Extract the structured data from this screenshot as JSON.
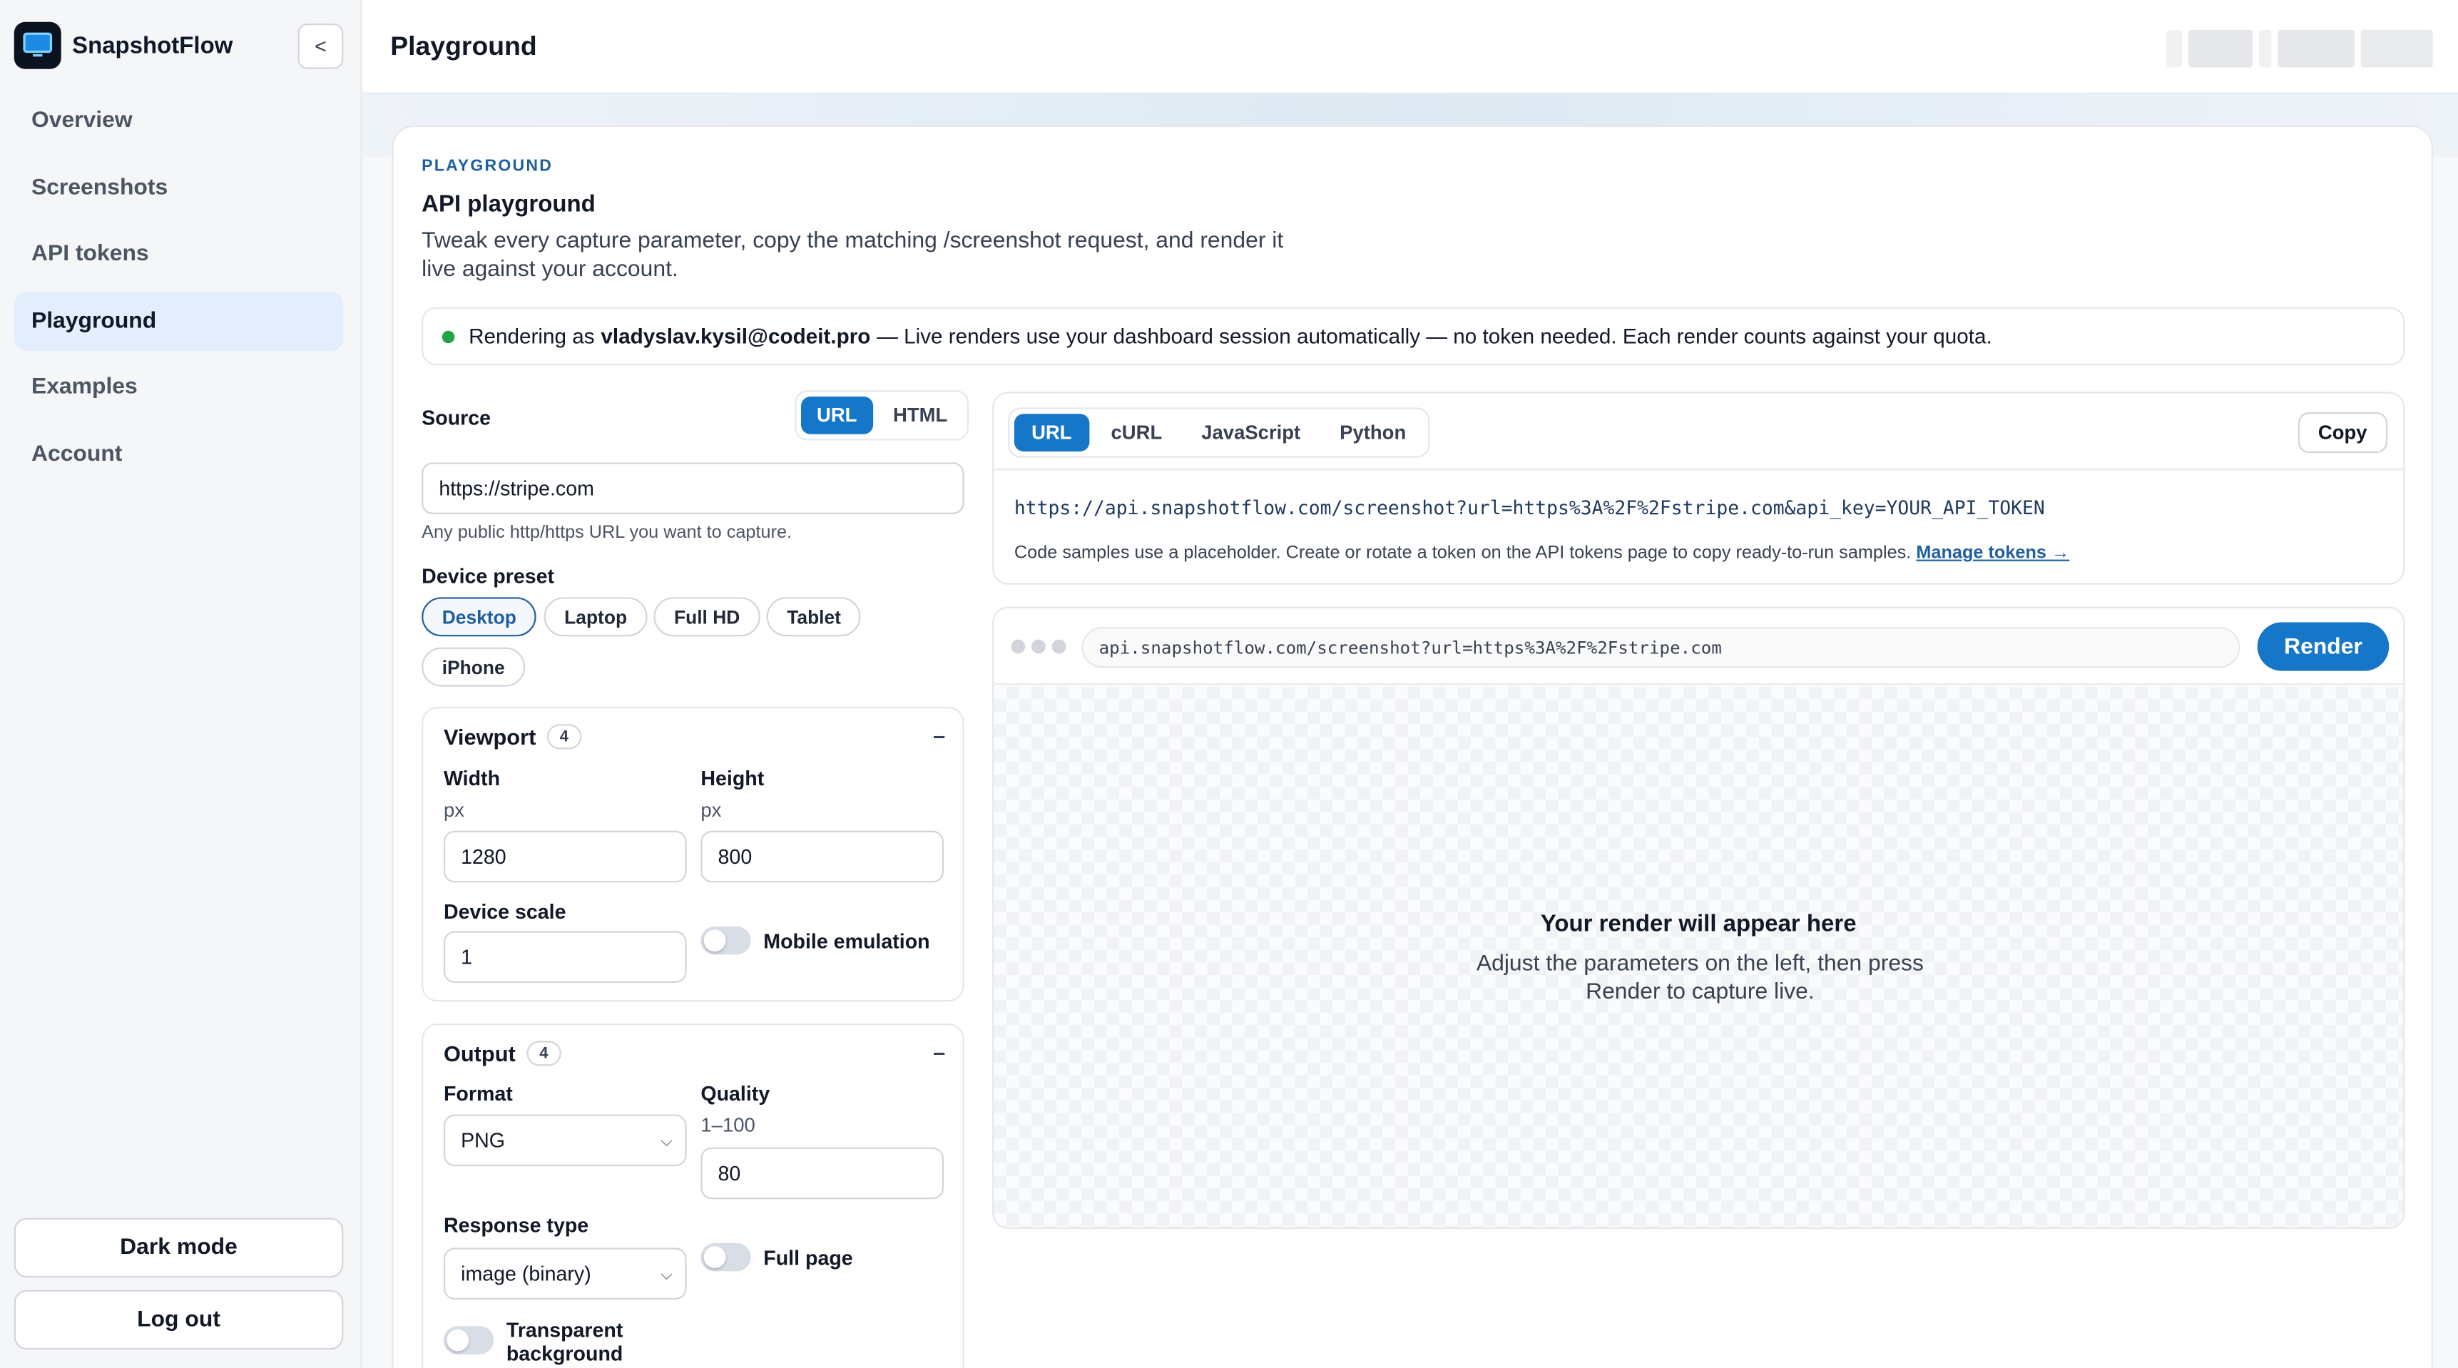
{
  "brand": {
    "name": "SnapshotFlow",
    "logo_icon": "monitor-icon",
    "collapse_label": "<"
  },
  "sidebar": {
    "items": [
      {
        "label": "Overview",
        "active": false
      },
      {
        "label": "Screenshots",
        "active": false
      },
      {
        "label": "API tokens",
        "active": false
      },
      {
        "label": "Playground",
        "active": true
      },
      {
        "label": "Examples",
        "active": false
      },
      {
        "label": "Account",
        "active": false
      }
    ],
    "dark_mode_label": "Dark mode",
    "logout_label": "Log out"
  },
  "header": {
    "title": "Playground"
  },
  "card": {
    "eyebrow": "PLAYGROUND",
    "title": "API playground",
    "description": "Tweak every capture parameter, copy the matching /screenshot request, and render it live against your account.",
    "status": {
      "prefix": "Rendering as",
      "email": "vladyslav.kysil@codeit.pro",
      "suffix": "— Live renders use your dashboard session automatically — no token needed. Each render counts against your quota."
    }
  },
  "source": {
    "label": "Source",
    "modes": [
      "URL",
      "HTML"
    ],
    "active_mode": "URL",
    "url_value": "https://stripe.com",
    "hint": "Any public http/https URL you want to capture."
  },
  "device_preset": {
    "label": "Device preset",
    "options": [
      "Desktop",
      "Laptop",
      "Full HD",
      "Tablet",
      "iPhone"
    ],
    "selected": "Desktop"
  },
  "viewport": {
    "title": "Viewport",
    "count": "4",
    "collapse_symbol": "–",
    "width_label": "Width",
    "width_unit": "px",
    "width_value": "1280",
    "height_label": "Height",
    "height_unit": "px",
    "height_value": "800",
    "scale_label": "Device scale",
    "scale_value": "1",
    "mobile_label": "Mobile emulation",
    "mobile_on": false
  },
  "output": {
    "title": "Output",
    "count": "4",
    "collapse_symbol": "–",
    "format_label": "Format",
    "format_value": "PNG",
    "quality_label": "Quality",
    "quality_range": "1–100",
    "quality_value": "80",
    "response_label": "Response type",
    "response_value": "image (binary)",
    "fullpage_label": "Full page",
    "fullpage_on": false,
    "transparent_label_1": "Transparent",
    "transparent_label_2": "background",
    "transparent_on": false
  },
  "code": {
    "tabs": [
      "URL",
      "cURL",
      "JavaScript",
      "Python"
    ],
    "active_tab": "URL",
    "copy_label": "Copy",
    "request_url": "https://api.snapshotflow.com/screenshot?url=https%3A%2F%2Fstripe.com&api_key=YOUR_API_TOKEN",
    "note": "Code samples use a placeholder. Create or rotate a token on the API tokens page to copy ready-to-run samples.",
    "manage_link": "Manage tokens →"
  },
  "preview": {
    "address": "api.snapshotflow.com/screenshot?url=https%3A%2F%2Fstripe.com",
    "render_label": "Render",
    "empty_title": "Your render will appear here",
    "empty_desc": "Adjust the parameters on the left, then press Render to capture live."
  },
  "colors": {
    "accent": "#1677c8",
    "active_nav": "#e3edfc",
    "status_ok": "#22a447"
  }
}
